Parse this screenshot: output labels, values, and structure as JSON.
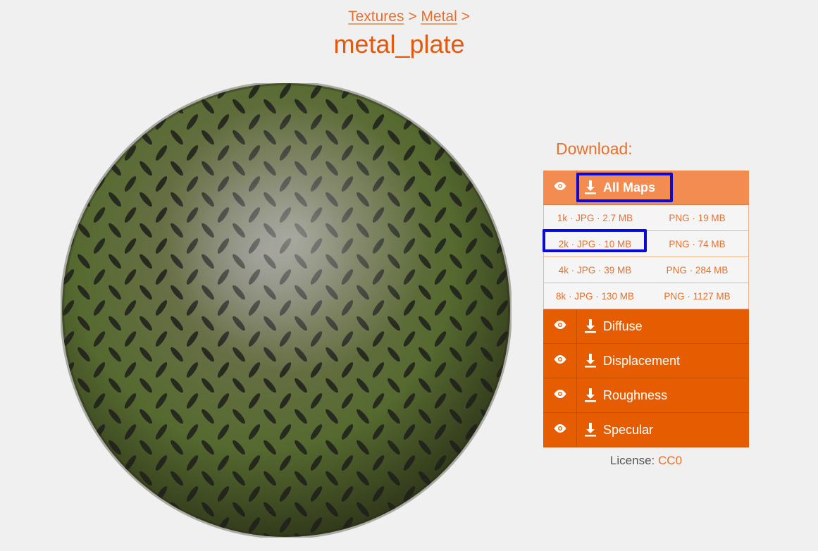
{
  "breadcrumb": {
    "items": [
      "Textures",
      "Metal"
    ],
    "separator": ">"
  },
  "title": "metal_plate",
  "download": {
    "heading": "Download:",
    "all_maps_label": "All Maps",
    "resolutions": [
      {
        "jpg": "1k · JPG · 2.7 MB",
        "png": "PNG · 19 MB"
      },
      {
        "jpg": "2k · JPG · 10 MB",
        "png": "PNG · 74 MB"
      },
      {
        "jpg": "4k · JPG · 39 MB",
        "png": "PNG · 284 MB"
      },
      {
        "jpg": "8k · JPG · 130 MB",
        "png": "PNG · 1127 MB"
      }
    ],
    "maps": [
      "Diffuse",
      "Displacement",
      "Roughness",
      "Specular"
    ]
  },
  "license": {
    "label": "License:",
    "value": "CC0"
  },
  "colors": {
    "accent": "#e65c00",
    "accent_light": "#f28c50",
    "highlight": "#0a0ad8",
    "background": "#f0f0f0"
  },
  "icons": [
    "eye-icon",
    "download-icon"
  ]
}
